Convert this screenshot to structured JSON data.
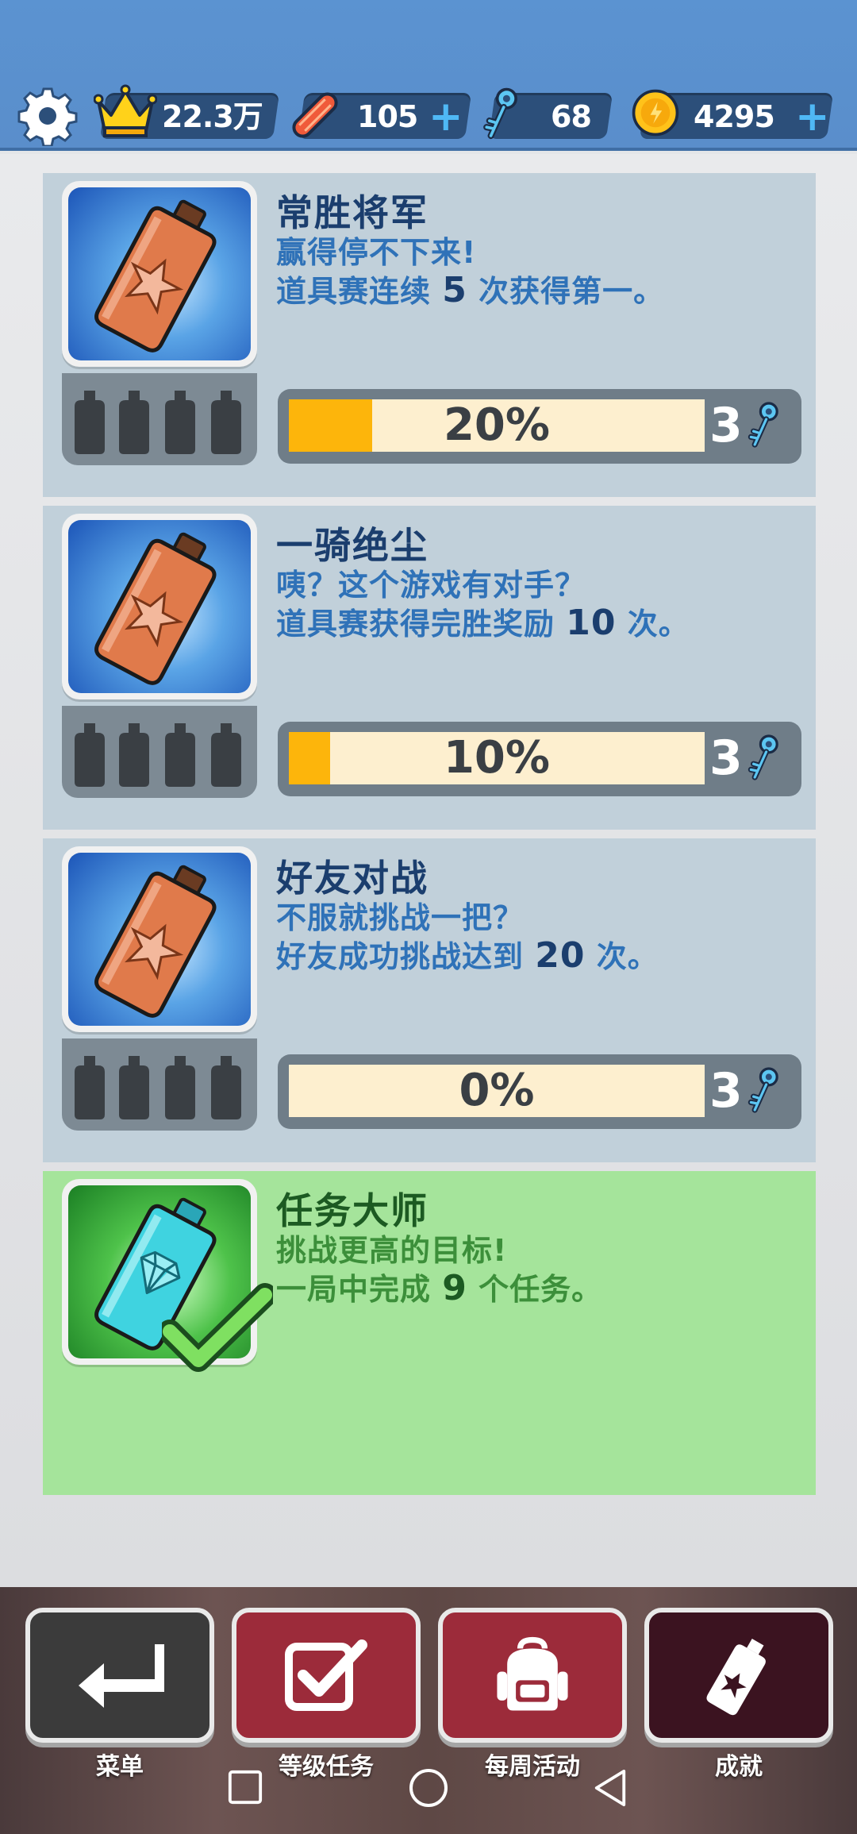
{
  "header": {
    "crown_value": "22.3万",
    "board_value": "105",
    "key_value": "68",
    "coin_value": "4295",
    "plus_symbol": "+"
  },
  "achievements": [
    {
      "title": "常胜将军",
      "line1": "赢得停不下来!",
      "line2_prefix": "道具赛连续 ",
      "line2_num": "5",
      "line2_suffix": " 次获得第一。",
      "progress_label": "20%",
      "progress": 0.2,
      "reward": "3",
      "state": "in-progress",
      "can_color": "copper"
    },
    {
      "title": "一骑绝尘",
      "line1": "咦？这个游戏有对手？",
      "line2_prefix": "道具赛获得完胜奖励 ",
      "line2_num": "10",
      "line2_suffix": " 次。",
      "progress_label": "10%",
      "progress": 0.1,
      "reward": "3",
      "state": "in-progress",
      "can_color": "copper"
    },
    {
      "title": "好友对战",
      "line1": "不服就挑战一把？",
      "line2_prefix": "好友成功挑战达到 ",
      "line2_num": "20",
      "line2_suffix": " 次。",
      "progress_label": "0%",
      "progress": 0,
      "reward": "3",
      "state": "in-progress",
      "can_color": "copper"
    },
    {
      "title": "任务大师",
      "line1": "挑战更高的目标!",
      "line2_prefix": "一局中完成 ",
      "line2_num": "9",
      "line2_suffix": " 个任务。",
      "state": "completed",
      "can_color": "diamond"
    }
  ],
  "bottom_nav": [
    {
      "label": "菜单",
      "icon": "return-arrow-icon",
      "color": "#3b3b3b"
    },
    {
      "label": "等级任务",
      "icon": "checkbox-icon",
      "color": "#9c2b3a"
    },
    {
      "label": "每周活动",
      "icon": "backpack-icon",
      "color": "#9c2b3a"
    },
    {
      "label": "成就",
      "icon": "spray-can-icon",
      "color": "#3b1320"
    }
  ],
  "colors": {
    "header_blue": "#5b93d1",
    "card_grey_blue": "#c1d0da",
    "card_done_green": "#a5e49b",
    "progress_orange": "#fdb50b",
    "title_navy": "#1b3e6e",
    "desc_blue": "#2f72b8"
  }
}
